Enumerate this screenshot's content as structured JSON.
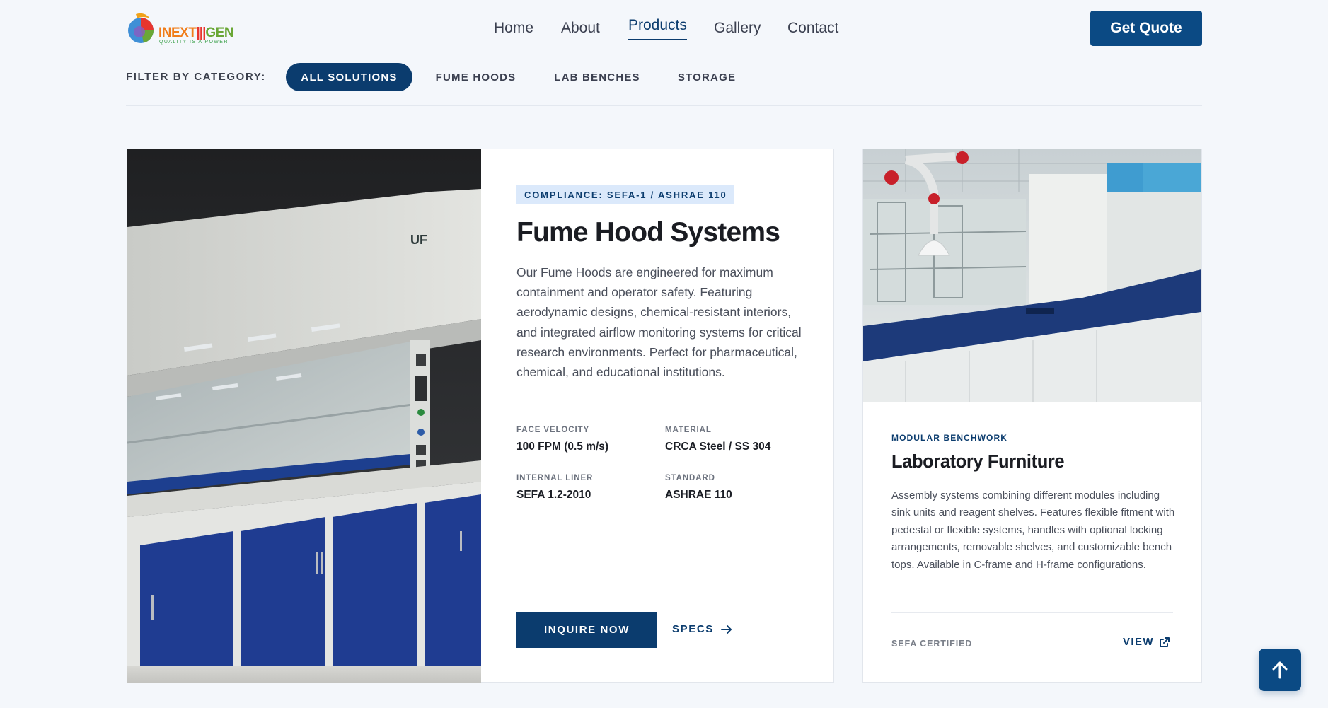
{
  "brand": {
    "logo_text_a": "INEXT",
    "logo_text_b": "GEN",
    "tagline": "QUALITY IS A POWER"
  },
  "nav": {
    "links": [
      {
        "label": "Home",
        "active": false
      },
      {
        "label": "About",
        "active": false
      },
      {
        "label": "Products",
        "active": true
      },
      {
        "label": "Gallery",
        "active": false
      },
      {
        "label": "Contact",
        "active": false
      }
    ],
    "cta_label": "Get Quote"
  },
  "filter": {
    "label": "FILTER BY CATEGORY:",
    "chips": [
      {
        "label": "ALL SOLUTIONS",
        "active": true
      },
      {
        "label": "FUME HOODS",
        "active": false
      },
      {
        "label": "LAB BENCHES",
        "active": false
      },
      {
        "label": "STORAGE",
        "active": false
      }
    ]
  },
  "fume_hood": {
    "badge": "COMPLIANCE: SEFA-1 / ASHRAE 110",
    "title": "Fume Hood Systems",
    "description": "Our Fume Hoods are engineered for maximum containment and operator safety. Featuring aerodynamic designs, chemical-resistant interiors, and integrated airflow monitoring systems for critical research environments. Perfect for pharmaceutical, chemical, and educational institutions.",
    "specs": [
      {
        "label": "FACE VELOCITY",
        "value": "100 FPM (0.5 m/s)"
      },
      {
        "label": "MATERIAL",
        "value": "CRCA Steel / SS 304"
      },
      {
        "label": "INTERNAL LINER",
        "value": "SEFA 1.2-2010"
      },
      {
        "label": "STANDARD",
        "value": "ASHRAE 110"
      }
    ],
    "inquire_label": "INQUIRE NOW",
    "specs_link_label": "SPECS"
  },
  "lab_furniture": {
    "kicker": "MODULAR BENCHWORK",
    "title": "Laboratory Furniture",
    "description": "Assembly systems combining different modules including sink units and reagent shelves. Features flexible fitment with pedestal or flexible systems, handles with optional locking arrangements, removable shelves, and customizable bench tops. Available in C-frame and H-frame configurations.",
    "badge": "SEFA CERTIFIED",
    "view_label": "VIEW"
  },
  "colors": {
    "primary": "#0b3c6e",
    "button": "#0b4a84",
    "badge_bg": "#dbe9fb",
    "background": "#f4f7fb"
  },
  "icons": {
    "logo": "inextgen-logo-icon",
    "specs_arrow": "arrow-right-icon",
    "view_external": "external-link-icon",
    "back_to_top": "arrow-up-icon"
  }
}
